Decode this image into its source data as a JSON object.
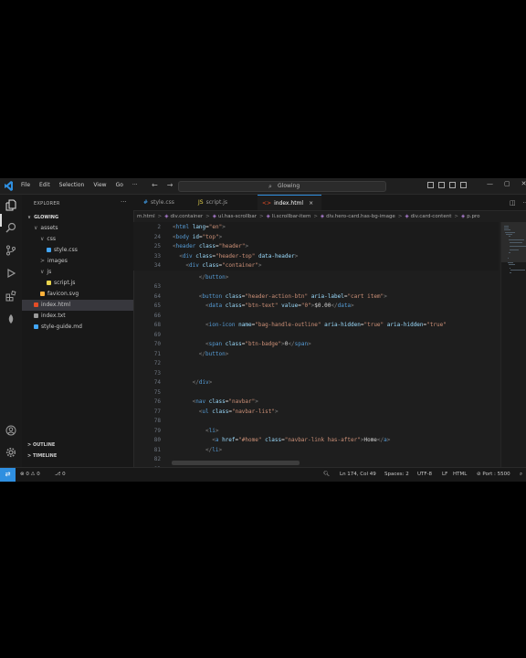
{
  "window": {
    "menu": [
      "File",
      "Edit",
      "Selection",
      "View",
      "Go",
      "···"
    ],
    "search_text": "Glowing",
    "nav_back": "←",
    "nav_forward": "→"
  },
  "sidebar": {
    "title": "EXPLORER",
    "more": "···",
    "root": "GLOWING",
    "tree": [
      {
        "label": "assets",
        "chev": "∨",
        "depth": 1,
        "type": "folder"
      },
      {
        "label": "css",
        "chev": "∨",
        "depth": 2,
        "type": "folder"
      },
      {
        "label": "style.css",
        "chev": "",
        "depth": 3,
        "type": "css"
      },
      {
        "label": "images",
        "chev": ">",
        "depth": 2,
        "type": "folder"
      },
      {
        "label": "js",
        "chev": "∨",
        "depth": 2,
        "type": "folder"
      },
      {
        "label": "script.js",
        "chev": "",
        "depth": 3,
        "type": "js"
      },
      {
        "label": "favicon.svg",
        "chev": "",
        "depth": 2,
        "type": "svg"
      },
      {
        "label": "index.html",
        "chev": "",
        "depth": 1,
        "type": "html",
        "selected": true
      },
      {
        "label": "index.txt",
        "chev": "",
        "depth": 1,
        "type": "txt"
      },
      {
        "label": "style-guide.md",
        "chev": "",
        "depth": 1,
        "type": "md"
      }
    ],
    "outline": "OUTLINE",
    "timeline": "TIMELINE"
  },
  "tabs": [
    {
      "label": "style.css",
      "icon": "#",
      "color": "#42a5f5"
    },
    {
      "label": "script.js",
      "icon": "JS",
      "color": "#e8d44d"
    },
    {
      "label": "index.html",
      "icon": "<>",
      "color": "#e44d26",
      "active": true,
      "close": "×"
    }
  ],
  "breadcrumb": [
    "m.html",
    "div.container",
    "ul.has-scrollbar",
    "li.scrollbar-item",
    "div.hero-card.has-bg-image",
    "div.card-content",
    "p.pro"
  ],
  "code": {
    "sticky": [
      {
        "n": "2",
        "text": "<html lang=\"en\">",
        "indent": 0
      },
      {
        "n": "24",
        "text": "<body id=\"top\">",
        "indent": 0
      },
      {
        "n": "25",
        "text": "<header class=\"header\">",
        "indent": 0
      },
      {
        "n": "33",
        "text": "<div class=\"header-top\" data-header>",
        "indent": 2
      },
      {
        "n": "34",
        "text": "<div class=\"container\">",
        "indent": 4
      }
    ],
    "lines": [
      {
        "n": "",
        "text": "</button>",
        "indent": 8
      },
      {
        "n": "63",
        "text": "",
        "indent": 0
      },
      {
        "n": "64",
        "text": "<button class=\"header-action-btn\" aria-label=\"cart item\">",
        "indent": 8
      },
      {
        "n": "65",
        "text": "<data class=\"btn-text\" value=\"0\">$0.00</data>",
        "indent": 10
      },
      {
        "n": "66",
        "text": "",
        "indent": 0
      },
      {
        "n": "68",
        "text": "<ion-icon name=\"bag-handle-outline\" aria-hidden=\"true\" aria-hidden=\"true\"",
        "indent": 10
      },
      {
        "n": "69",
        "text": "",
        "indent": 0
      },
      {
        "n": "70",
        "text": "<span class=\"btn-badge\">0</span>",
        "indent": 10
      },
      {
        "n": "71",
        "text": "</button>",
        "indent": 8
      },
      {
        "n": "72",
        "text": "",
        "indent": 0
      },
      {
        "n": "73",
        "text": "",
        "indent": 0
      },
      {
        "n": "74",
        "text": "</div>",
        "indent": 6
      },
      {
        "n": "75",
        "text": "",
        "indent": 0
      },
      {
        "n": "76",
        "text": "<nav class=\"navbar\">",
        "indent": 6
      },
      {
        "n": "77",
        "text": "<ul class=\"navbar-list\">",
        "indent": 8
      },
      {
        "n": "78",
        "text": "",
        "indent": 0
      },
      {
        "n": "79",
        "text": "<li>",
        "indent": 10
      },
      {
        "n": "80",
        "text": "<a href=\"#home\" class=\"navbar-link has-after\">Home</a>",
        "indent": 12
      },
      {
        "n": "81",
        "text": "</li>",
        "indent": 10
      },
      {
        "n": "82",
        "text": "",
        "indent": 0
      },
      {
        "n": "83",
        "text": "",
        "indent": 0
      }
    ]
  },
  "status": {
    "errors": "0",
    "warnings": "0",
    "ports": "0",
    "position": "Ln 174, Col 49",
    "spaces": "Spaces: 2",
    "encoding": "UTF-8",
    "eol": "LF",
    "language": "HTML",
    "port": "Port : 5500"
  },
  "colors": {
    "tag": "#569cd6",
    "attr": "#9cdcfe",
    "string": "#ce9178",
    "punct": "#808080",
    "text": "#d4d4d4",
    "accent": "#2f8fe0"
  }
}
